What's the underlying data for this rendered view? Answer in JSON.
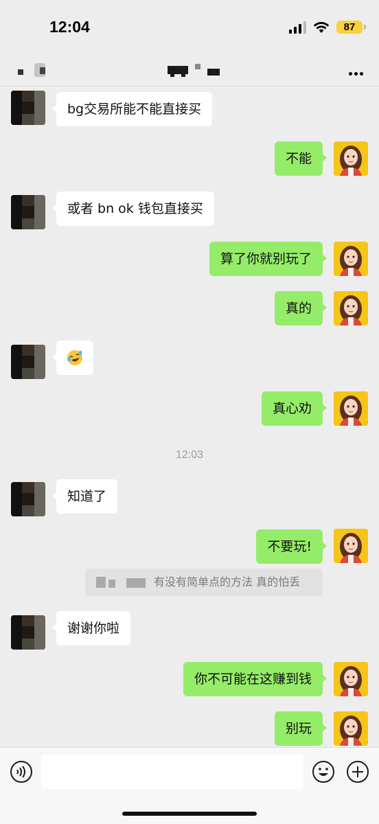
{
  "status": {
    "time": "12:04",
    "battery": "87"
  },
  "header": {
    "more_label": "More"
  },
  "messages": [
    {
      "side": "in",
      "text": "bg交易所能不能直接买"
    },
    {
      "side": "out",
      "text": "不能"
    },
    {
      "side": "in",
      "text": "或者 bn ok 钱包直接买"
    },
    {
      "side": "out",
      "text": "算了你就别玩了"
    },
    {
      "side": "out",
      "text": "真的"
    },
    {
      "side": "in",
      "emoji": "laughing-crying-emoji"
    },
    {
      "side": "out",
      "text": "真心劝"
    },
    {
      "side": "in",
      "text": "知道了"
    },
    {
      "side": "out",
      "text": "不要玩!"
    },
    {
      "side": "in",
      "text": "谢谢你啦"
    },
    {
      "side": "out",
      "text": "你不可能在这赚到钱"
    },
    {
      "side": "out",
      "text": "别玩"
    }
  ],
  "timestamp": "12:03",
  "quote": {
    "text": "有没有简单点的方法 真的怕丢"
  },
  "input": {
    "placeholder": ""
  },
  "colors": {
    "outgoing_bubble": "#95ec69",
    "incoming_bubble": "#ffffff",
    "background": "#ededed"
  }
}
